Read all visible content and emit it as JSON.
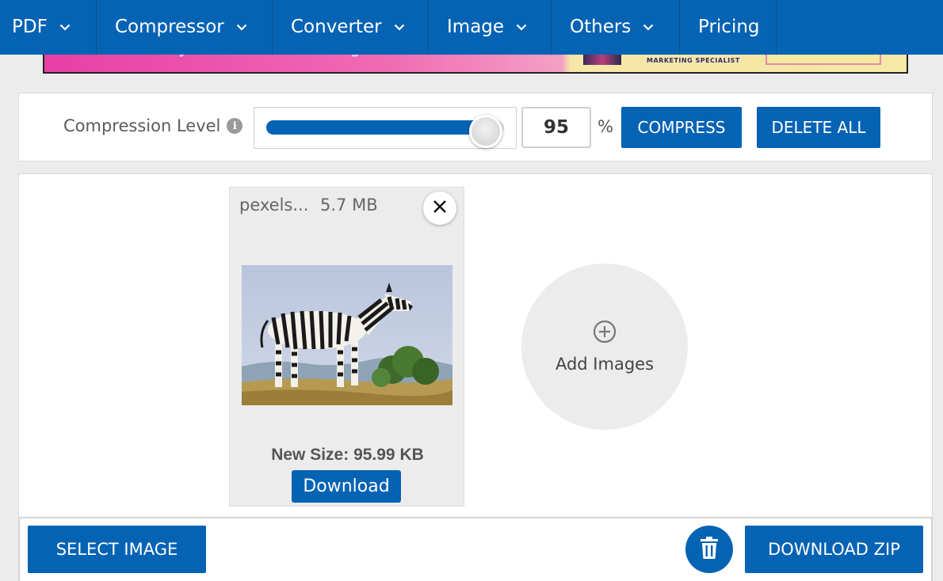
{
  "nav": {
    "items": [
      {
        "label": "PDF",
        "has_dropdown": true
      },
      {
        "label": "Compressor",
        "has_dropdown": true
      },
      {
        "label": "Converter",
        "has_dropdown": true
      },
      {
        "label": "Image",
        "has_dropdown": true
      },
      {
        "label": "Others",
        "has_dropdown": true
      },
      {
        "label": "Pricing",
        "has_dropdown": false
      }
    ]
  },
  "banner": {
    "text": "Take your career to new heights.",
    "tag": "MARKETING SPECIALIST"
  },
  "compression": {
    "label": "Compression Level",
    "info_icon": "info-icon",
    "value": "95",
    "level_percent": 95,
    "unit": "%",
    "compress_label": "COMPRESS",
    "delete_all_label": "DELETE ALL"
  },
  "file_card": {
    "name": "pexels...",
    "size": "5.7 MB",
    "close_icon": "close-icon",
    "new_size": "New Size: 95.99 KB",
    "download_label": "Download"
  },
  "add_images": {
    "icon": "plus-circle-icon",
    "label": "Add Images"
  },
  "bottom": {
    "select_label": "SELECT IMAGE",
    "trash_icon": "trash-icon",
    "zip_label": "DOWNLOAD ZIP"
  },
  "colors": {
    "primary": "#0563b4",
    "background": "#ececec"
  }
}
